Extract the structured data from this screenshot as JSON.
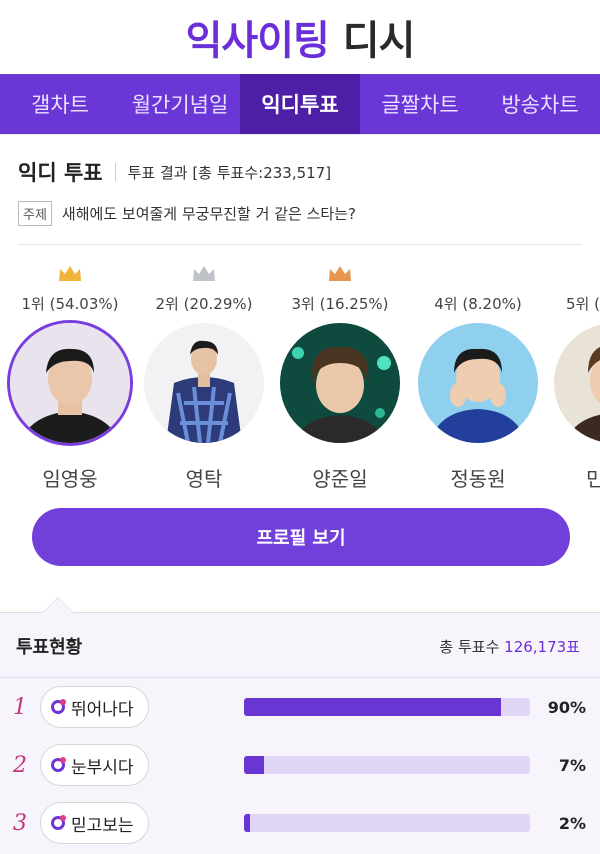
{
  "logo": {
    "part1": "익사이팅",
    "part2": "디시"
  },
  "nav": [
    "갤차트",
    "월간기념일",
    "익디투표",
    "글짤차트",
    "방송차트"
  ],
  "vote": {
    "title": "익디 투표",
    "result": "투표 결과 [총 투표수:233,517]",
    "topic_badge": "주제",
    "topic": "새해에도 보여줄게 무궁무진할 거 같은 스타는?"
  },
  "candidates": [
    {
      "rank": "1위 (54.03%)",
      "name": "임영웅",
      "crown": "gold"
    },
    {
      "rank": "2위 (20.29%)",
      "name": "영탁",
      "crown": "silver"
    },
    {
      "rank": "3위 (16.25%)",
      "name": "양준일",
      "crown": "bronze"
    },
    {
      "rank": "4위 (8.20%)",
      "name": "정동원",
      "crown": ""
    },
    {
      "rank": "5위 (",
      "name": "민",
      "crown": ""
    }
  ],
  "profile_button": "프로필 보기",
  "status": {
    "title": "투표현황",
    "total_label": "총 투표수",
    "total_value": "126,173표",
    "rows": [
      {
        "rank": "1",
        "label": "뛰어나다",
        "percent": "90%",
        "fill": 0.9
      },
      {
        "rank": "2",
        "label": "눈부시다",
        "percent": "7%",
        "fill": 0.07
      },
      {
        "rank": "3",
        "label": "믿고보는",
        "percent": "2%",
        "fill": 0.02
      }
    ]
  },
  "colors": {
    "brand": "#6b36d6",
    "brand_dark": "#4c1fa6",
    "rank_accent": "#c3347a"
  }
}
